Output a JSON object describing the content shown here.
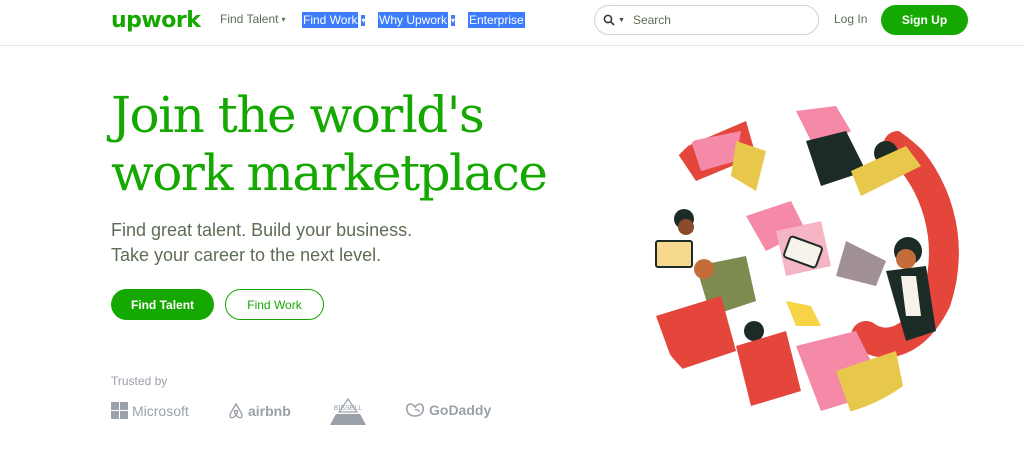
{
  "header": {
    "logo": "upwork",
    "nav": [
      {
        "label": "Find Talent",
        "selected": false
      },
      {
        "label": "Find Work",
        "selected": true
      },
      {
        "label": "Why Upwork",
        "selected": true
      },
      {
        "label": "Enterprise",
        "selected": true
      }
    ],
    "caret": "▾",
    "search": {
      "placeholder": "Search",
      "icon": "search-icon",
      "dropdown_icon": "caret-down-icon"
    },
    "login_label": "Log In",
    "signup_label": "Sign Up"
  },
  "hero": {
    "headline_line1": "Join the world's",
    "headline_line2": "work marketplace",
    "sub_line1": "Find great talent. Build your business.",
    "sub_line2": "Take your career to the next level.",
    "find_talent_label": "Find Talent",
    "find_work_label": "Find Work",
    "illustration": "collaboration-illustration"
  },
  "trusted": {
    "label": "Trusted by",
    "brands": [
      {
        "name": "Microsoft",
        "icon": "microsoft-logo"
      },
      {
        "name": "airbnb",
        "icon": "airbnb-logo"
      },
      {
        "name": "BISSELL",
        "icon": "bissell-logo"
      },
      {
        "name": "GoDaddy",
        "icon": "godaddy-logo"
      }
    ]
  },
  "colors": {
    "brand": "#14a800",
    "text_muted": "#5e6d55",
    "selection": "#3d7dfd"
  }
}
